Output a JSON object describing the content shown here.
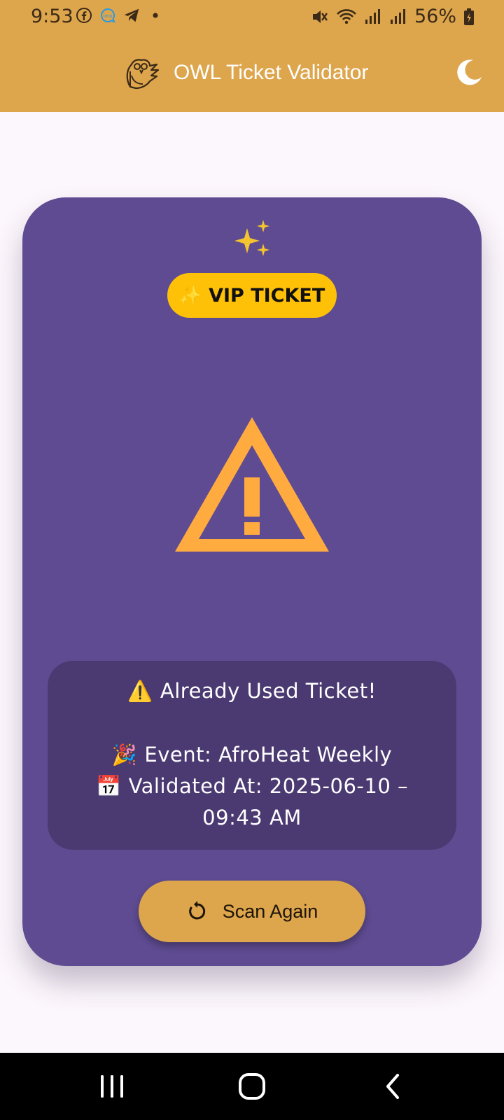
{
  "status_bar": {
    "time": "9:53",
    "left_icons": [
      "facebook-icon",
      "imo-icon",
      "telegram-icon",
      "dot-icon"
    ],
    "right_icons": [
      "mute-icon",
      "wifi-icon",
      "signal-icon",
      "signal-icon"
    ],
    "battery_percent": "56%"
  },
  "app_bar": {
    "title": "OWL Ticket Validator",
    "logo_icon": "owl-logo-icon",
    "theme_icon": "moon-icon",
    "background": "#dda54c"
  },
  "card": {
    "background": "#5e4b91",
    "sparkle_icon": "sparkles-icon",
    "badge": {
      "emoji": "✨",
      "label": "VIP TICKET",
      "background": "#ffc107"
    },
    "status_icon": "warning-triangle-icon",
    "status_icon_color": "#ffab40",
    "info": {
      "status_emoji": "⚠️",
      "status_text": "Already Used Ticket!",
      "event_emoji": "🎉",
      "event_text": "Event: AfroHeat Weekly",
      "validated_emoji": "📅",
      "validated_text": "Validated At: 2025-06-10 –",
      "validated_time": "09:43 AM"
    },
    "scan_button": {
      "icon": "refresh-icon",
      "label": "Scan Again"
    }
  },
  "nav_bar": {
    "buttons": [
      "recents-icon",
      "home-icon",
      "back-icon"
    ]
  }
}
